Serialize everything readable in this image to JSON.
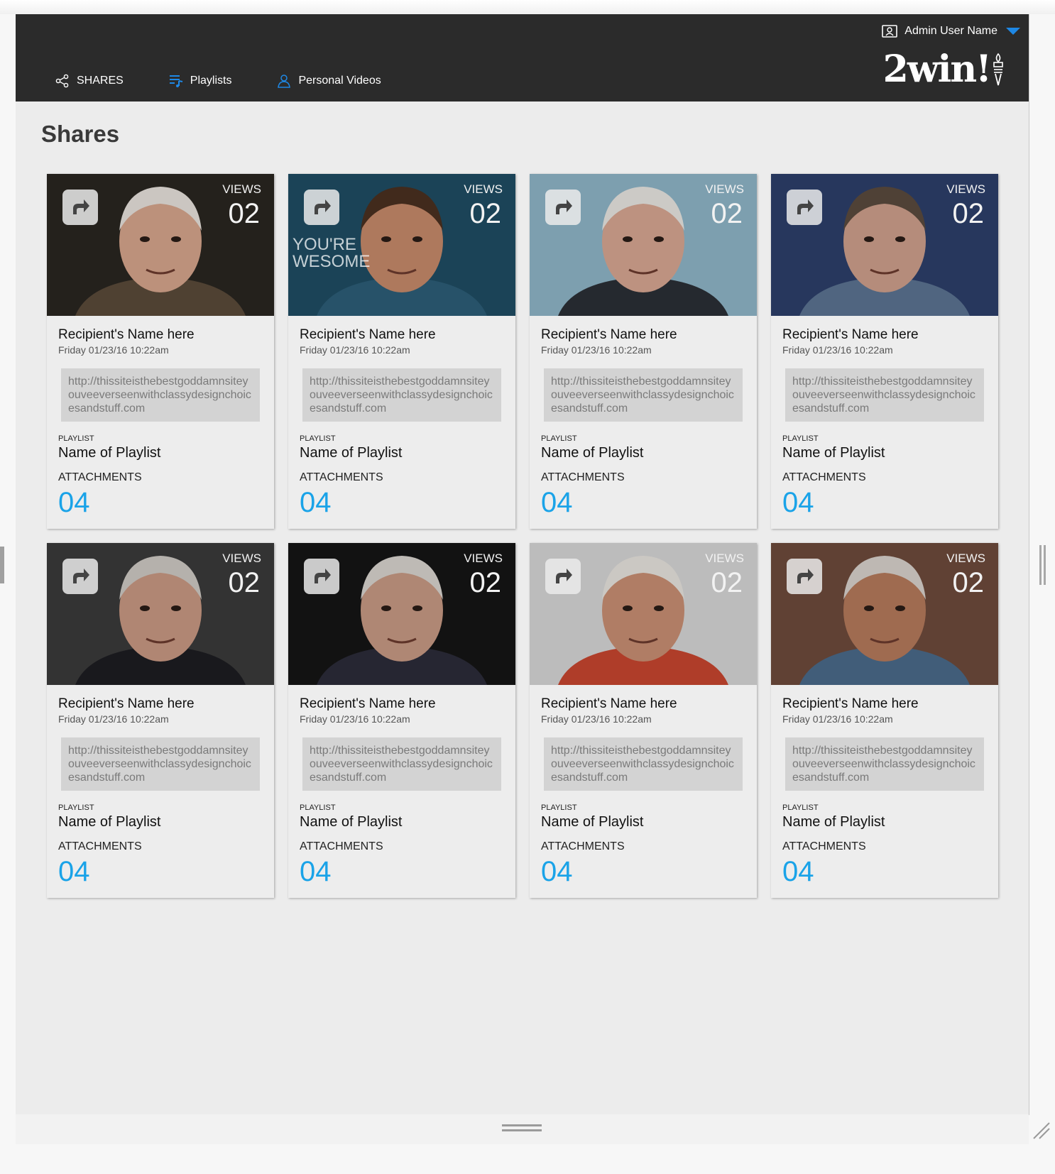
{
  "header": {
    "user_name": "Admin User Name",
    "nav": [
      {
        "label": "SHARES",
        "icon": "share-icon"
      },
      {
        "label": "Playlists",
        "icon": "playlist-icon"
      },
      {
        "label": "Personal Videos",
        "icon": "person-icon"
      }
    ],
    "logo_text": "2win!"
  },
  "page": {
    "title": "Shares"
  },
  "colors": {
    "accent": "#1aa3e8",
    "header_bg": "#2b2b2b",
    "dropdown_caret": "#1e88e5"
  },
  "cards": [
    {
      "views_label": "VIEWS",
      "views": "02",
      "recipient": "Recipient's Name here",
      "date": "Friday 01/23/16 10:22am",
      "url": "http://thissiteisthebestgoddamnsiteyouveeverseenwithclassydesignchoicesandstuff.com",
      "playlist_label": "PLAYLIST",
      "playlist": "Name of Playlist",
      "attachments_label": "ATTACHMENTS",
      "attachments": "04"
    },
    {
      "views_label": "VIEWS",
      "views": "02",
      "recipient": "Recipient's Name here",
      "date": "Friday 01/23/16 10:22am",
      "url": "http://thissiteisthebestgoddamnsiteyouveeverseenwithclassydesignchoicesandstuff.com",
      "playlist_label": "PLAYLIST",
      "playlist": "Name of Playlist",
      "attachments_label": "ATTACHMENTS",
      "attachments": "04",
      "image_caption": "YOU'RE\nWESOME"
    },
    {
      "views_label": "VIEWS",
      "views": "02",
      "recipient": "Recipient's Name here",
      "date": "Friday 01/23/16 10:22am",
      "url": "http://thissiteisthebestgoddamnsiteyouveeverseenwithclassydesignchoicesandstuff.com",
      "playlist_label": "PLAYLIST",
      "playlist": "Name of Playlist",
      "attachments_label": "ATTACHMENTS",
      "attachments": "04"
    },
    {
      "views_label": "VIEWS",
      "views": "02",
      "recipient": "Recipient's Name here",
      "date": "Friday 01/23/16 10:22am",
      "url": "http://thissiteisthebestgoddamnsiteyouveeverseenwithclassydesignchoicesandstuff.com",
      "playlist_label": "PLAYLIST",
      "playlist": "Name of Playlist",
      "attachments_label": "ATTACHMENTS",
      "attachments": "04"
    },
    {
      "views_label": "VIEWS",
      "views": "02",
      "recipient": "Recipient's Name here",
      "date": "Friday 01/23/16 10:22am",
      "url": "http://thissiteisthebestgoddamnsiteyouveeverseenwithclassydesignchoicesandstuff.com",
      "playlist_label": "PLAYLIST",
      "playlist": "Name of Playlist",
      "attachments_label": "ATTACHMENTS",
      "attachments": "04"
    },
    {
      "views_label": "VIEWS",
      "views": "02",
      "recipient": "Recipient's Name here",
      "date": "Friday 01/23/16 10:22am",
      "url": "http://thissiteisthebestgoddamnsiteyouveeverseenwithclassydesignchoicesandstuff.com",
      "playlist_label": "PLAYLIST",
      "playlist": "Name of Playlist",
      "attachments_label": "ATTACHMENTS",
      "attachments": "04"
    },
    {
      "views_label": "VIEWS",
      "views": "02",
      "recipient": "Recipient's Name here",
      "date": "Friday 01/23/16 10:22am",
      "url": "http://thissiteisthebestgoddamnsiteyouveeverseenwithclassydesignchoicesandstuff.com",
      "playlist_label": "PLAYLIST",
      "playlist": "Name of Playlist",
      "attachments_label": "ATTACHMENTS",
      "attachments": "04"
    },
    {
      "views_label": "VIEWS",
      "views": "02",
      "recipient": "Recipient's Name here",
      "date": "Friday 01/23/16 10:22am",
      "url": "http://thissiteisthebestgoddamnsiteyouveeverseenwithclassydesignchoicesandstuff.com",
      "playlist_label": "PLAYLIST",
      "playlist": "Name of Playlist",
      "attachments_label": "ATTACHMENTS",
      "attachments": "04"
    }
  ],
  "thumbnails": [
    {
      "bg": "#2a2620",
      "skin": "#d6a58c",
      "hair": "#e8e2dc",
      "shirt": "#5a4a3a"
    },
    {
      "bg": "#1f4d63",
      "skin": "#c78a6a",
      "hair": "#4a3020",
      "shirt": "#2d5e78"
    },
    {
      "bg": "#8fb6c8",
      "skin": "#d8a792",
      "hair": "#e9e6e2",
      "shirt": "#2b2f36"
    },
    {
      "bg": "#2d3f6a",
      "skin": "#cfa08c",
      "hair": "#5a4a3e",
      "shirt": "#5c7392"
    },
    {
      "bg": "#3b3b3b",
      "skin": "#c99983",
      "hair": "#cfcac4",
      "shirt": "#1d1d22"
    },
    {
      "bg": "#151515",
      "skin": "#c89a84",
      "hair": "#d9d4cf",
      "shirt": "#2c2c3a"
    },
    {
      "bg": "#d7d7d7",
      "skin": "#c98f73",
      "hair": "#e8e4df",
      "shirt": "#c8462f"
    },
    {
      "bg": "#6e4a3c",
      "skin": "#b57a5c",
      "hair": "#d9d2cc",
      "shirt": "#4a6a8a"
    }
  ]
}
